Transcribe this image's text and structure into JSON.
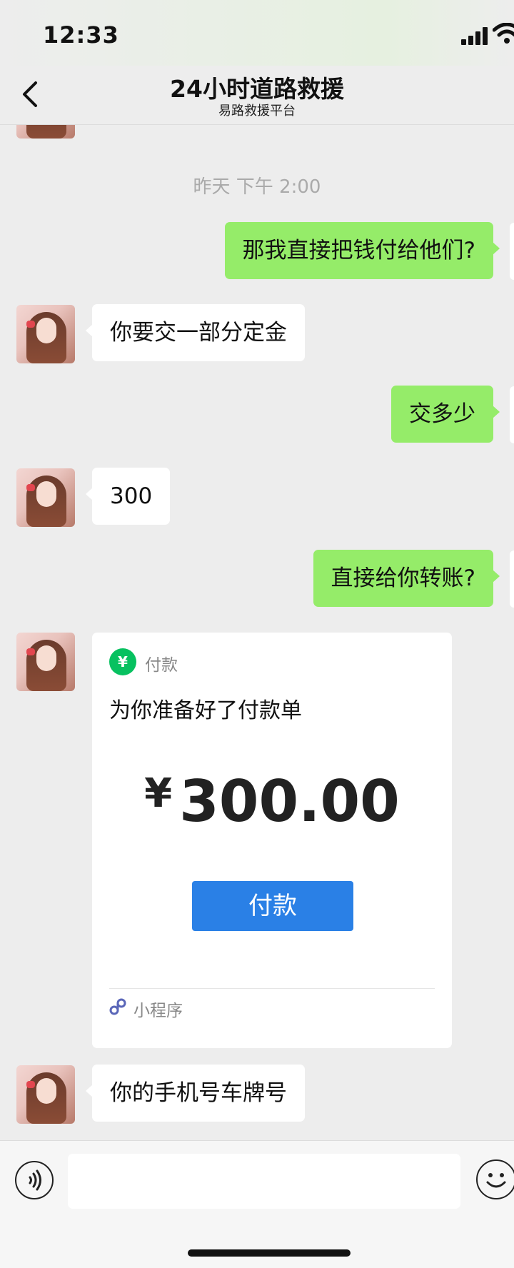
{
  "status_bar": {
    "time": "12:33"
  },
  "header": {
    "title": "24小时道路救援",
    "subtitle": "易路救援平台"
  },
  "chat": {
    "timestamp": "昨天 下午 2:00",
    "messages": [
      {
        "side": "right",
        "text": "那我直接把钱付给他们?"
      },
      {
        "side": "left",
        "text": "你要交一部分定金"
      },
      {
        "side": "right",
        "text": "交多少"
      },
      {
        "side": "left",
        "text": "300"
      },
      {
        "side": "right",
        "text": "直接给你转账?"
      },
      {
        "side": "left",
        "text": "你的手机号车牌号"
      }
    ],
    "payment_card": {
      "source": "付款",
      "description": "为你准备好了付款单",
      "currency_symbol": "¥",
      "amount": "300.00",
      "button_label": "付款",
      "footer_label": "小程序",
      "icon_glyph": "¥"
    }
  },
  "colors": {
    "sent_bubble": "#95ec69",
    "pay_button": "#2a80e6",
    "pay_icon": "#07c160"
  }
}
